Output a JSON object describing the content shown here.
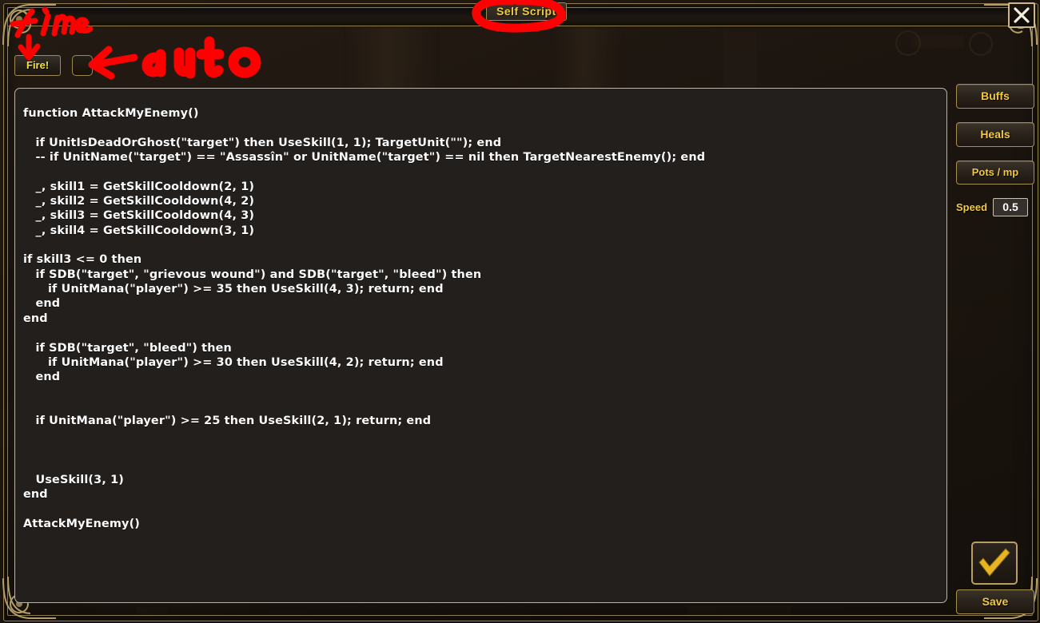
{
  "window": {
    "title": "Self Script",
    "close_label": "✕"
  },
  "toolbar": {
    "fire_label": "Fire!",
    "auto_checkbox_checked": false
  },
  "editor": {
    "code": "function AttackMyEnemy()\n\n   if UnitIsDeadOrGhost(\"target\") then UseSkill(1, 1); TargetUnit(\"\"); end\n   -- if UnitName(\"target\") == \"Assassîn\" or UnitName(\"target\") == nil then TargetNearestEnemy(); end\n\n   _, skill1 = GetSkillCooldown(2, 1)\n   _, skill2 = GetSkillCooldown(4, 2)\n   _, skill3 = GetSkillCooldown(4, 3)\n   _, skill4 = GetSkillCooldown(3, 1)\n\nif skill3 <= 0 then\n   if SDB(\"target\", \"grievous wound\") and SDB(\"target\", \"bleed\") then\n      if UnitMana(\"player\") >= 35 then UseSkill(4, 3); return; end\n   end\nend\n\n   if SDB(\"target\", \"bleed\") then\n      if UnitMana(\"player\") >= 30 then UseSkill(4, 2); return; end\n   end\n\n\n   if UnitMana(\"player\") >= 25 then UseSkill(2, 1); return; end\n\n\n\n   UseSkill(3, 1)\nend\n\nAttackMyEnemy()"
  },
  "sidebar": {
    "buttons": [
      {
        "label": "Buffs",
        "name": "buffs-button"
      },
      {
        "label": "Heals",
        "name": "heals-button"
      },
      {
        "label": "Pots / mp",
        "name": "pots-mp-button"
      }
    ],
    "speed_label": "Speed",
    "speed_value": "0.5"
  },
  "save": {
    "label": "Save",
    "checkmark_icon": "checkmark-icon"
  },
  "annotations": {
    "title_circle": "red circle around title",
    "one_time": "1time",
    "auto": "auto",
    "arrow_down": "downward arrow to Fire button",
    "arrow_left": "leftward arrow to auto checkbox"
  },
  "colors": {
    "accent_gold": "#f2c93d",
    "frame_gold": "#b09a64",
    "annotation_red": "#fe0000",
    "code_bg": "#221f1d",
    "code_text": "#fbfbfb"
  }
}
